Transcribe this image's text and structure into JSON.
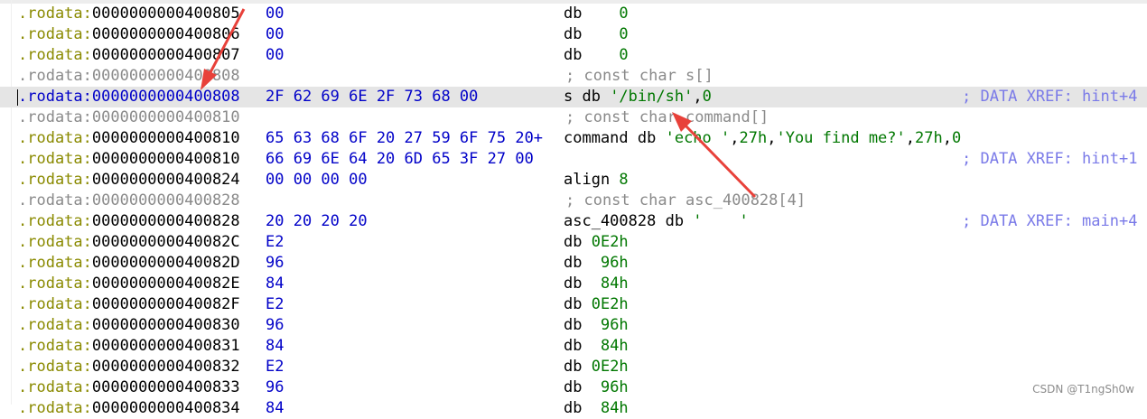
{
  "rows": [
    {
      "seg": ".rodata:",
      "addr": "0000000000400805",
      "bytes": "00",
      "instr": "db    ",
      "num": "0"
    },
    {
      "seg": ".rodata:",
      "addr": "0000000000400806",
      "bytes": "00",
      "instr": "db    ",
      "num": "0"
    },
    {
      "seg": ".rodata:",
      "addr": "0000000000400807",
      "bytes": "00",
      "instr": "db    ",
      "num": "0"
    },
    {
      "seg": ".rodata:",
      "addr": "0000000000400808",
      "comment": "; const char s[]"
    },
    {
      "seg": ".rodata:",
      "addr": "0000000000400808",
      "bytes": "2F 62 69 6E 2F 73 68 00",
      "instr": "s db ",
      "str": "'/bin/sh'",
      "tail": ",",
      "num": "0",
      "xref": "; DATA XREF: hint+4"
    },
    {
      "seg": ".rodata:",
      "addr": "0000000000400810",
      "comment": "; const char command[]"
    },
    {
      "seg": ".rodata:",
      "addr": "0000000000400810",
      "bytes": "65 63 68 6F 20 27 59 6F 75 20+",
      "instr": "command db ",
      "str": "'echo '",
      "tail": ",",
      "str2": "27h",
      "tail2": ",",
      "str3": "'You find me?'",
      "tail3": ",",
      "str4": "27h",
      "tail4": ",",
      "num": "0"
    },
    {
      "seg": ".rodata:",
      "addr": "0000000000400810",
      "bytes": "66 69 6E 64 20 6D 65 3F 27 00",
      "xref": "; DATA XREF: hint+1"
    },
    {
      "seg": ".rodata:",
      "addr": "0000000000400824",
      "bytes": "00 00 00 00",
      "instr": "align ",
      "num": "8"
    },
    {
      "seg": ".rodata:",
      "addr": "0000000000400828",
      "comment": "; const char asc_400828[4]"
    },
    {
      "seg": ".rodata:",
      "addr": "0000000000400828",
      "bytes": "20 20 20 20",
      "instr": "asc_400828 db ",
      "str": "'    '",
      "xref": "; DATA XREF: main+4"
    },
    {
      "seg": ".rodata:",
      "addr": "000000000040082C",
      "bytes": "E2",
      "instr": "db ",
      "num": "0E2h"
    },
    {
      "seg": ".rodata:",
      "addr": "000000000040082D",
      "bytes": "96",
      "instr": "db  ",
      "num": "96h"
    },
    {
      "seg": ".rodata:",
      "addr": "000000000040082E",
      "bytes": "84",
      "instr": "db  ",
      "num": "84h"
    },
    {
      "seg": ".rodata:",
      "addr": "000000000040082F",
      "bytes": "E2",
      "instr": "db ",
      "num": "0E2h"
    },
    {
      "seg": ".rodata:",
      "addr": "0000000000400830",
      "bytes": "96",
      "instr": "db  ",
      "num": "96h"
    },
    {
      "seg": ".rodata:",
      "addr": "0000000000400831",
      "bytes": "84",
      "instr": "db  ",
      "num": "84h"
    },
    {
      "seg": ".rodata:",
      "addr": "0000000000400832",
      "bytes": "E2",
      "instr": "db ",
      "num": "0E2h"
    },
    {
      "seg": ".rodata:",
      "addr": "0000000000400833",
      "bytes": "96",
      "instr": "db  ",
      "num": "96h"
    },
    {
      "seg": ".rodata:",
      "addr": "0000000000400834",
      "bytes": "84",
      "instr": "db  ",
      "num": "84h"
    }
  ],
  "selected_row": 4,
  "watermark": "CSDN @T1ngSh0w",
  "colors": {
    "segment": "#8a8a00",
    "bytes": "#0000c8",
    "string": "#007700",
    "comment": "#8a8a8a",
    "xref": "#7a7ae8",
    "selection": "#e5e5e5",
    "arrow": "#e8413a"
  }
}
